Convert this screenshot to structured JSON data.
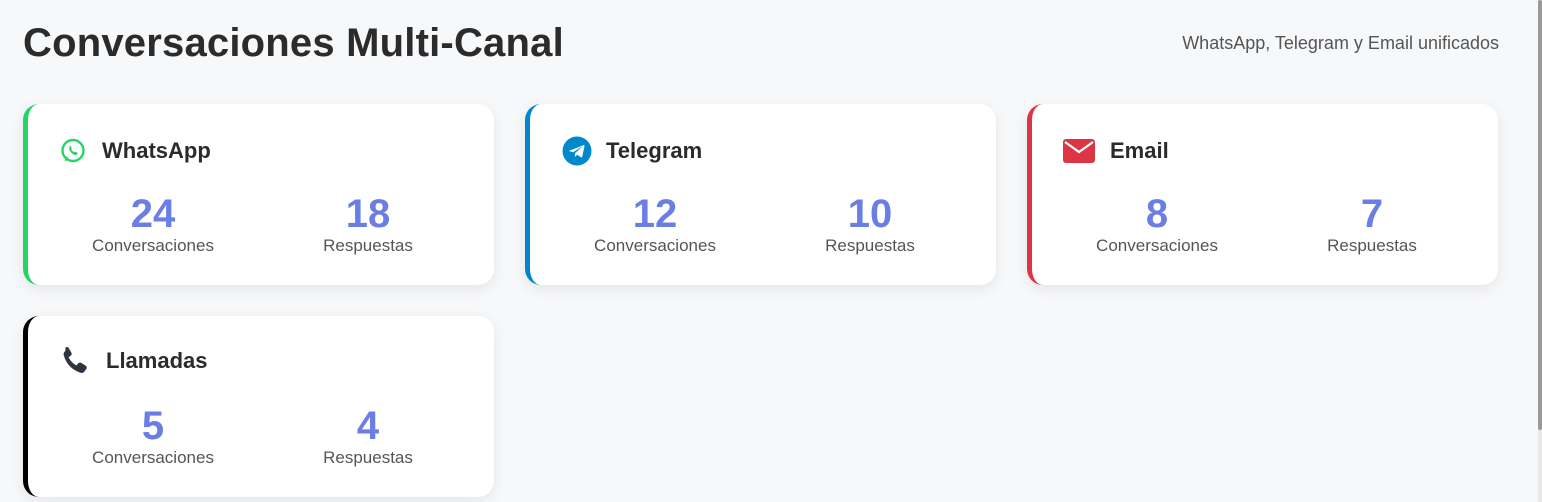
{
  "header": {
    "title": "Conversaciones Multi-Canal",
    "subtitle": "WhatsApp, Telegram y Email unificados"
  },
  "cards": [
    {
      "name": "WhatsApp",
      "icon": "whatsapp-icon",
      "color": "#25d366",
      "conversations": "24",
      "conversations_label": "Conversaciones",
      "responses": "18",
      "responses_label": "Respuestas"
    },
    {
      "name": "Telegram",
      "icon": "telegram-icon",
      "color": "#0088cc",
      "conversations": "12",
      "conversations_label": "Conversaciones",
      "responses": "10",
      "responses_label": "Respuestas"
    },
    {
      "name": "Email",
      "icon": "email-icon",
      "color": "#dc3545",
      "conversations": "8",
      "conversations_label": "Conversaciones",
      "responses": "7",
      "responses_label": "Respuestas"
    },
    {
      "name": "Llamadas",
      "icon": "phone-icon",
      "color": "#000000",
      "conversations": "5",
      "conversations_label": "Conversaciones",
      "responses": "4",
      "responses_label": "Respuestas"
    }
  ],
  "colors": {
    "stat_value": "#6b7ee3",
    "background": "#f7f8fa"
  }
}
